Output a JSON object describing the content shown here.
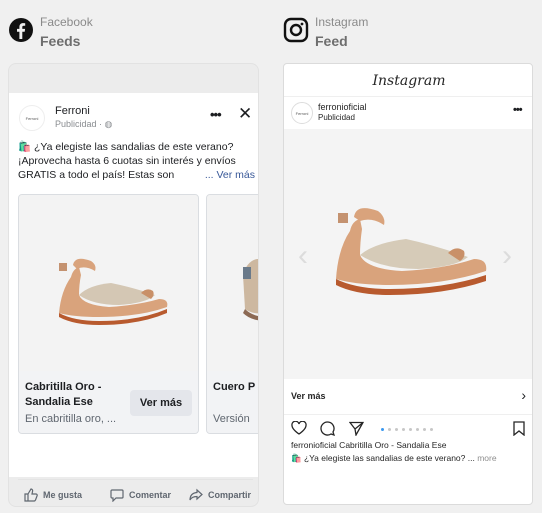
{
  "facebook": {
    "platform": "Facebook",
    "placement": "Feeds",
    "post": {
      "logo_text": "Ferroni",
      "page_name": "Ferroni",
      "sponsored": "Publicidad · ",
      "text": "🛍️ ¿Ya elegiste las sandalias de este verano? ¡Aprovecha hasta 6 cuotas sin interés y envíos GRATIS a todo el país! Estas son",
      "see_more": "... Ver más",
      "cards": [
        {
          "title": "Cabritilla Oro - Sandalia Ese",
          "subtitle": "En cabritilla oro, ...",
          "cta": "Ver más"
        },
        {
          "title": "Cuero P",
          "subtitle": "Versión"
        }
      ],
      "actions": {
        "like": "Me gusta",
        "comment": "Comentar",
        "share": "Compartir"
      }
    }
  },
  "instagram": {
    "platform": "Instagram",
    "placement": "Feed",
    "logo": "Instagram",
    "logo_text": "Ferroni",
    "username": "ferronioficial",
    "sponsored": "Publicidad",
    "cta": "Ver más",
    "carousel_dots": 8,
    "active_dot": 1,
    "caption_line1": "ferronioficial Cabritilla Oro - Sandalia Ese",
    "caption_line2": "🛍️ ¿Ya elegiste las sandalias de este verano? ...",
    "more": "more"
  }
}
